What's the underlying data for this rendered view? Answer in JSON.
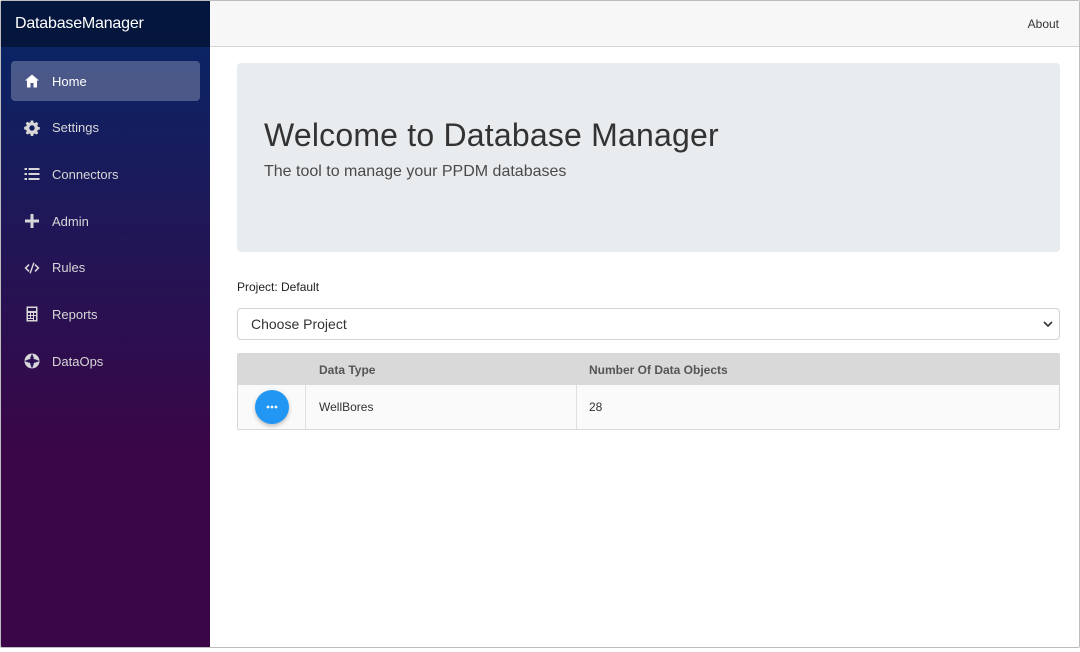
{
  "brand": "DatabaseManager",
  "top_row": {
    "about": "About"
  },
  "sidebar": {
    "items": [
      {
        "label": "Home",
        "icon": "home-icon",
        "active": true
      },
      {
        "label": "Settings",
        "icon": "gear-icon"
      },
      {
        "label": "Connectors",
        "icon": "list-icon"
      },
      {
        "label": "Admin",
        "icon": "plus-icon"
      },
      {
        "label": "Rules",
        "icon": "code-icon"
      },
      {
        "label": "Reports",
        "icon": "calculator-icon"
      },
      {
        "label": "DataOps",
        "icon": "aperture-icon"
      }
    ]
  },
  "jumbotron": {
    "title": "Welcome to Database Manager",
    "lead": "The tool to manage your PPDM databases"
  },
  "project": {
    "current": "Project: Default",
    "select_value": "Choose Project"
  },
  "grid": {
    "columns": [
      "Data Type",
      "Number Of Data Objects"
    ],
    "rows": [
      {
        "data_type": "WellBores",
        "count": "28"
      }
    ]
  },
  "colors": {
    "sidebar_top": "#052767",
    "sidebar_bottom": "#3a0647",
    "action_button": "#2196f3",
    "jumbotron": "#e9ecef"
  }
}
